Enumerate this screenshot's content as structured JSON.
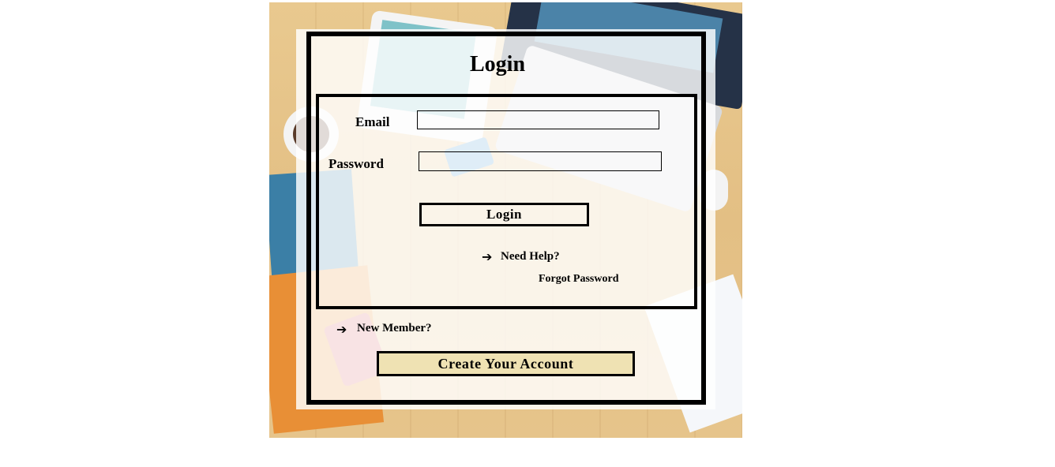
{
  "form": {
    "title": "Login",
    "email_label": "Email",
    "email_value": "",
    "password_label": "Password",
    "password_value": "",
    "login_button": "Login",
    "need_help": "Need Help?",
    "forgot_password": "Forgot Password",
    "new_member": "New Member?",
    "create_account_button": "Create Your Account",
    "arrow_glyph": "➔"
  },
  "colors": {
    "create_button_bg": "#efe2b3",
    "border": "#000000",
    "panel_overlay": "rgba(255,255,255,0.82)"
  }
}
